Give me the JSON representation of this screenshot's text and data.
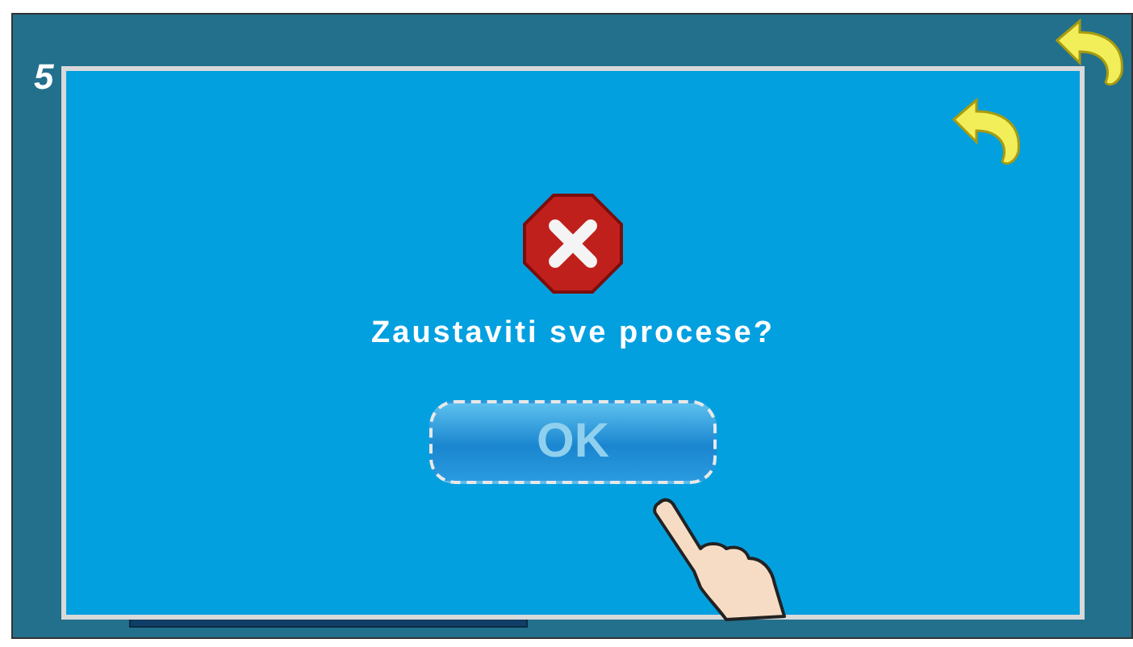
{
  "screen": {
    "title": "5"
  },
  "dialog": {
    "message": "Zaustaviti sve procese?",
    "button": "OK"
  }
}
